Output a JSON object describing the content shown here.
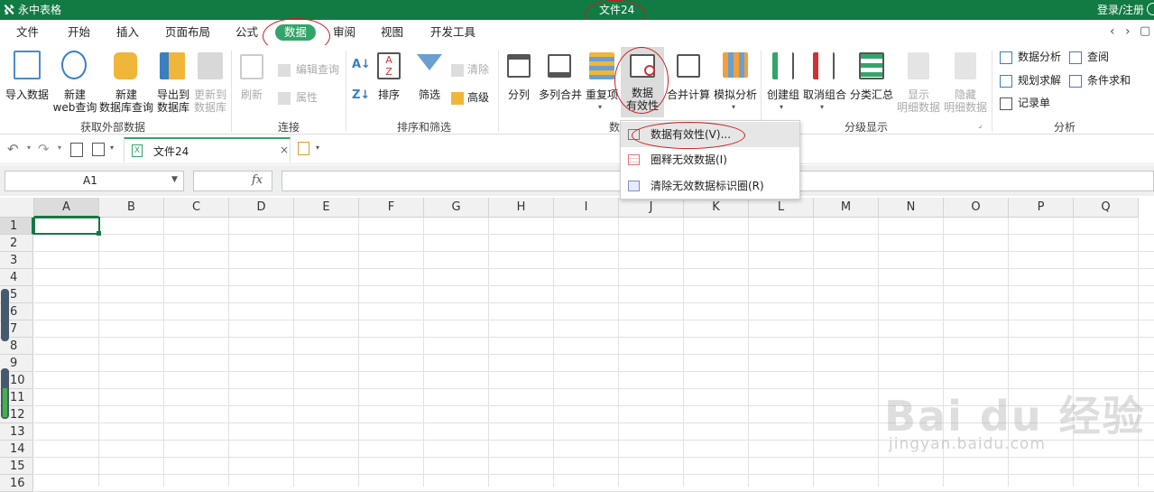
{
  "titlebar": {
    "app_name": "永中表格",
    "document": "文件24",
    "login": "登录/注册"
  },
  "menubar": {
    "items": [
      "文件",
      "开始",
      "插入",
      "页面布局",
      "公式",
      "数据",
      "审阅",
      "视图",
      "开发工具"
    ],
    "active": "数据"
  },
  "ribbon": {
    "external": {
      "import": "导入数据",
      "web_1": "新建",
      "web_2": "web查询",
      "db_1": "新建",
      "db_2": "数据库查询",
      "export_1": "导出到",
      "export_2": "数据库",
      "update_1": "更新到",
      "update_2": "数据库",
      "group": "获取外部数据"
    },
    "connect": {
      "refresh": "刷新",
      "edit_query": "编辑查询",
      "properties": "属性",
      "group": "连接"
    },
    "sort": {
      "sort": "排序",
      "filter": "筛选",
      "clear": "清除",
      "advanced": "高级",
      "group": "排序和筛选"
    },
    "datatools": {
      "split": "分列",
      "multi_merge": "多列合并",
      "duplicates": "重复项",
      "validity_1": "数据",
      "validity_2": "有效性",
      "consolidate": "合并计算",
      "whatif": "模拟分析",
      "group_partial": "数"
    },
    "outline": {
      "group_create": "创建组",
      "ungroup": "取消组合",
      "subtotal": "分类汇总",
      "show_1": "显示",
      "show_2": "明细数据",
      "hide_1": "隐藏",
      "hide_2": "明细数据",
      "group": "分级显示"
    },
    "analysis": {
      "data_analysis": "数据分析",
      "query": "查阅",
      "solver": "规划求解",
      "cond_sum": "条件求和",
      "record": "记录单",
      "group": "分析"
    }
  },
  "qat": {
    "tab_name": "文件24"
  },
  "formula": {
    "namebox": "A1",
    "fx": "fx"
  },
  "grid": {
    "columns": [
      "A",
      "B",
      "C",
      "D",
      "E",
      "F",
      "G",
      "H",
      "I",
      "J",
      "K",
      "L",
      "M",
      "N",
      "O",
      "P",
      "Q"
    ],
    "rows": [
      "1",
      "2",
      "3",
      "4",
      "5",
      "6",
      "7",
      "8",
      "9",
      "10",
      "11",
      "12",
      "13",
      "14",
      "15",
      "16"
    ]
  },
  "dropdown": {
    "items": [
      "数据有效性(V)...",
      "圈释无效数据(I)",
      "清除无效数据标识圈(R)"
    ]
  },
  "watermark": {
    "text": "jingyan.baidu.com"
  },
  "colors": {
    "brand": "#127a43",
    "active_tab": "#33a56a",
    "highlight_circle": "#c81e1e"
  }
}
